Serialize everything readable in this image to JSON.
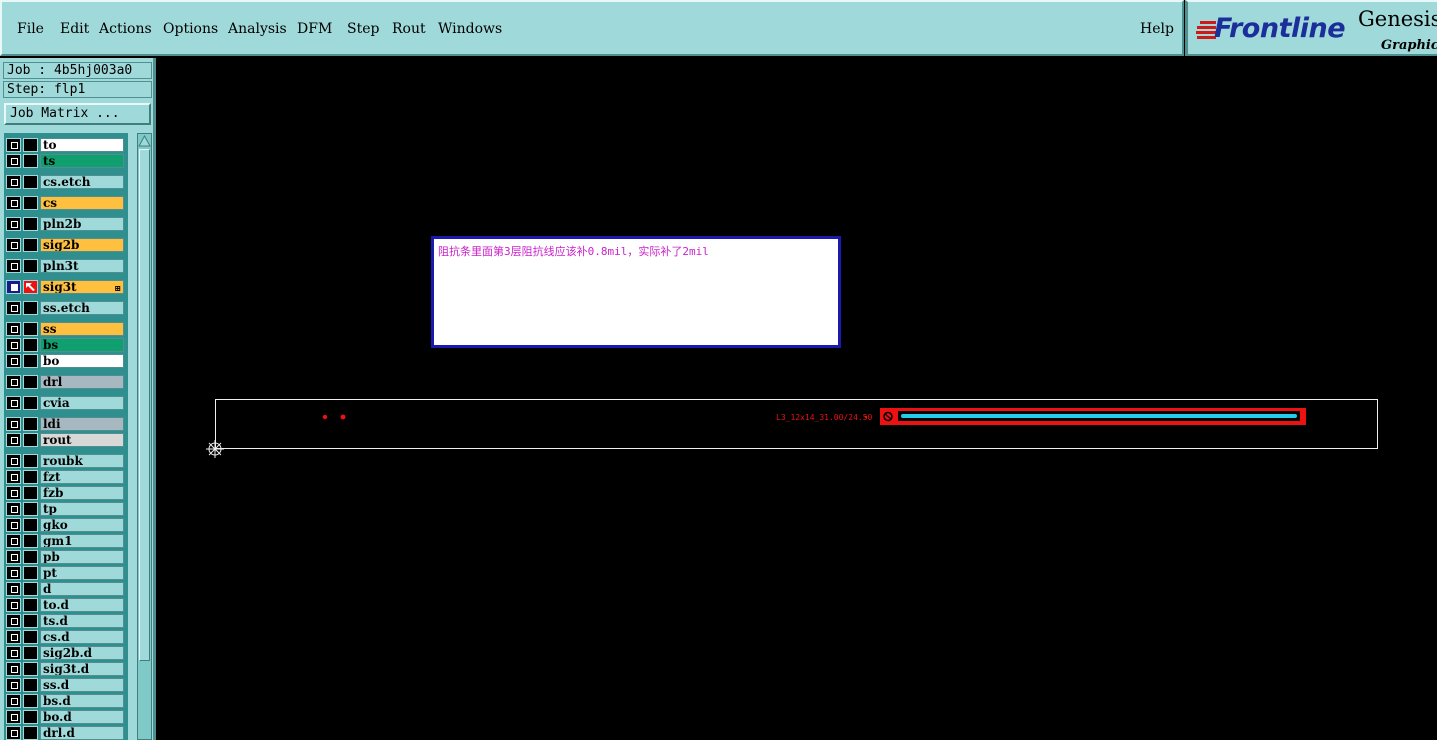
{
  "menubar": {
    "items": [
      {
        "label": "File",
        "underline": true
      },
      {
        "label": "Edit",
        "underline": true
      },
      {
        "label": "Actions",
        "underline": true
      },
      {
        "label": "Options",
        "underline": false
      },
      {
        "label": "Analysis",
        "underline": false
      },
      {
        "label": "DFM",
        "underline": false
      },
      {
        "label": "Step",
        "underline": true
      },
      {
        "label": "Rout",
        "underline": true
      },
      {
        "label": "Windows",
        "underline": true
      }
    ],
    "help": "Help"
  },
  "brand": {
    "logo": "Frontline",
    "product": "Genesis",
    "subtitle": "Graphic E"
  },
  "job": {
    "job_label": "Job : 4b5hj003a0",
    "step_label": "Step: flp1",
    "matrix_button": "Job Matrix ..."
  },
  "layers": [
    {
      "name": "to",
      "color": "#ffffff",
      "gap_before": false
    },
    {
      "name": "ts",
      "color": "#10a070",
      "gap_before": false
    },
    {
      "name": "cs.etch",
      "color": "#9fd9d9",
      "gap_before": true
    },
    {
      "name": "cs",
      "color": "#ffc040",
      "gap_before": true
    },
    {
      "name": "pln2b",
      "color": "#9fd9d9",
      "gap_before": true
    },
    {
      "name": "sig2b",
      "color": "#ffc040",
      "gap_before": true
    },
    {
      "name": "pln3t",
      "color": "#9fd9d9",
      "gap_before": true
    },
    {
      "name": "sig3t",
      "color": "#ffc040",
      "gap_before": true,
      "active": true,
      "work": true
    },
    {
      "name": "ss.etch",
      "color": "#9fd9d9",
      "gap_before": true
    },
    {
      "name": "ss",
      "color": "#ffc040",
      "gap_before": true
    },
    {
      "name": "bs",
      "color": "#10a070",
      "gap_before": false
    },
    {
      "name": "bo",
      "color": "#ffffff",
      "gap_before": false
    },
    {
      "name": "drl",
      "color": "#a8b8c0",
      "gap_before": true
    },
    {
      "name": "cvia",
      "color": "#9fd9d9",
      "gap_before": true
    },
    {
      "name": "ldi",
      "color": "#a8b8c0",
      "gap_before": true
    },
    {
      "name": "rout",
      "color": "#d8d8d8",
      "gap_before": false
    },
    {
      "name": "roubk",
      "color": "#9fd9d9",
      "gap_before": true
    },
    {
      "name": "fzt",
      "color": "#9fd9d9",
      "gap_before": false
    },
    {
      "name": "fzb",
      "color": "#9fd9d9",
      "gap_before": false
    },
    {
      "name": "tp",
      "color": "#9fd9d9",
      "gap_before": false
    },
    {
      "name": "gko",
      "color": "#9fd9d9",
      "gap_before": false
    },
    {
      "name": "gm1",
      "color": "#9fd9d9",
      "gap_before": false
    },
    {
      "name": "pb",
      "color": "#9fd9d9",
      "gap_before": false
    },
    {
      "name": "pt",
      "color": "#9fd9d9",
      "gap_before": false
    },
    {
      "name": "d",
      "color": "#9fd9d9",
      "gap_before": false
    },
    {
      "name": "to.d",
      "color": "#9fd9d9",
      "gap_before": false
    },
    {
      "name": "ts.d",
      "color": "#9fd9d9",
      "gap_before": false
    },
    {
      "name": "cs.d",
      "color": "#9fd9d9",
      "gap_before": false
    },
    {
      "name": "sig2b.d",
      "color": "#9fd9d9",
      "gap_before": false
    },
    {
      "name": "sig3t.d",
      "color": "#9fd9d9",
      "gap_before": false
    },
    {
      "name": "ss.d",
      "color": "#9fd9d9",
      "gap_before": false
    },
    {
      "name": "bs.d",
      "color": "#9fd9d9",
      "gap_before": false
    },
    {
      "name": "bo.d",
      "color": "#9fd9d9",
      "gap_before": false
    },
    {
      "name": "drl.d",
      "color": "#9fd9d9",
      "gap_before": false
    }
  ],
  "canvas": {
    "note_text": "阻抗条里面第3层阻抗线应该补0.8mil，实际补了2mil",
    "coupon_label": "L3_12x14_31.00/24.50",
    "background": "#000000",
    "feature_color": "#ee1111",
    "trace_color": "#22ccee"
  }
}
